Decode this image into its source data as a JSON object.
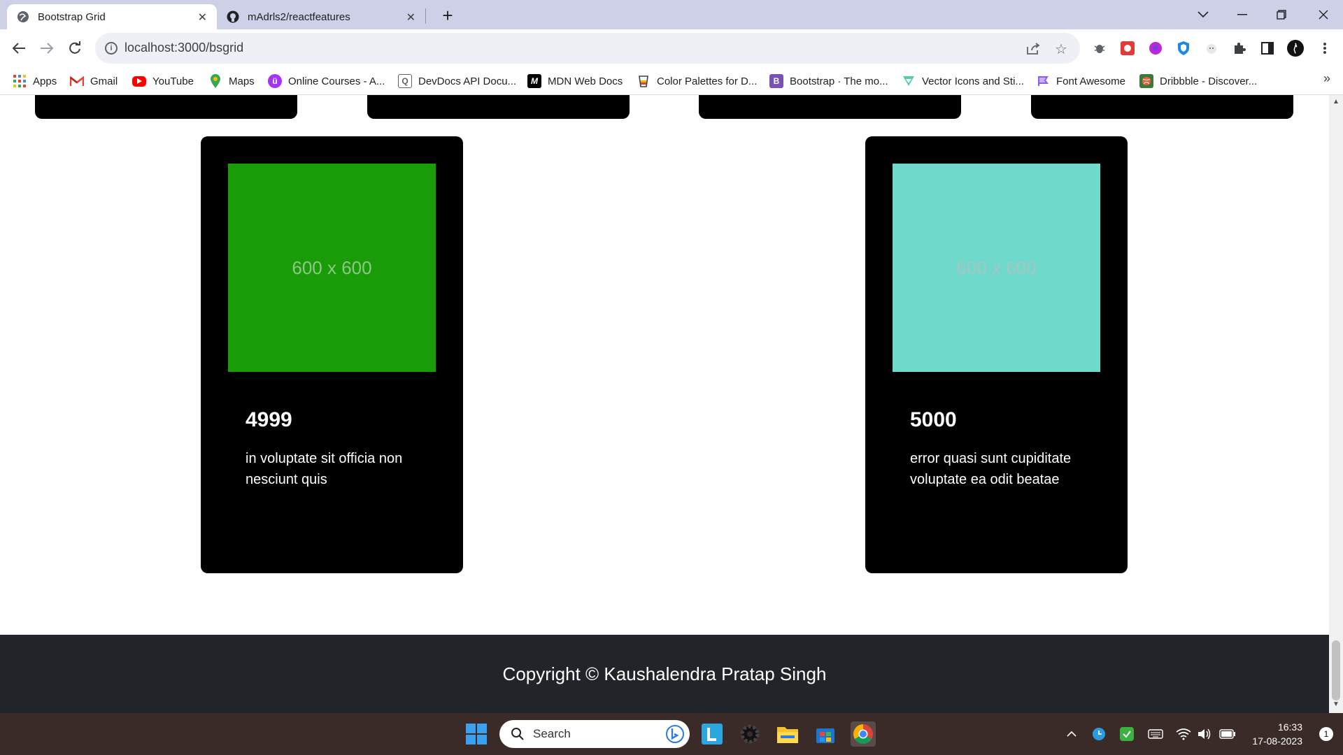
{
  "browser": {
    "tabs": [
      {
        "title": "Bootstrap Grid",
        "active": true
      },
      {
        "title": "mAdrls2/reactfeatures",
        "active": false
      }
    ],
    "url": "localhost:3000/bsgrid",
    "bookmarks": [
      {
        "label": "Apps",
        "icon": "apps-grid-icon"
      },
      {
        "label": "Gmail",
        "icon": "gmail-icon"
      },
      {
        "label": "YouTube",
        "icon": "youtube-icon"
      },
      {
        "label": "Maps",
        "icon": "maps-icon"
      },
      {
        "label": "Online Courses - A...",
        "icon": "udemy-icon"
      },
      {
        "label": "DevDocs API Docu...",
        "icon": "devdocs-icon"
      },
      {
        "label": "MDN Web Docs",
        "icon": "mdn-icon"
      },
      {
        "label": "Color Palettes for D...",
        "icon": "color-palette-icon"
      },
      {
        "label": "Bootstrap · The mo...",
        "icon": "bootstrap-icon"
      },
      {
        "label": "Vector Icons and Sti...",
        "icon": "flaticon-icon"
      },
      {
        "label": "Font Awesome",
        "icon": "font-awesome-icon"
      },
      {
        "label": "Dribbble - Discover...",
        "icon": "dribbble-icon"
      }
    ]
  },
  "page": {
    "cards": [
      {
        "image_label": "600 x 600",
        "image_color": "#1a9b08",
        "image_text_color": "#8cc885",
        "price": "4999",
        "description": "in voluptate sit officia non nesciunt quis"
      },
      {
        "image_label": "600 x 600",
        "image_color": "#6fd9cc",
        "image_text_color": "#a5c6c2",
        "price": "5000",
        "description": "error quasi sunt cupiditate voluptate ea odit beatae"
      }
    ],
    "footer": "Copyright © Kaushalendra Pratap Singh"
  },
  "taskbar": {
    "search_placeholder": "Search",
    "time": "16:33",
    "date": "17-08-2023",
    "notification_count": "1"
  }
}
